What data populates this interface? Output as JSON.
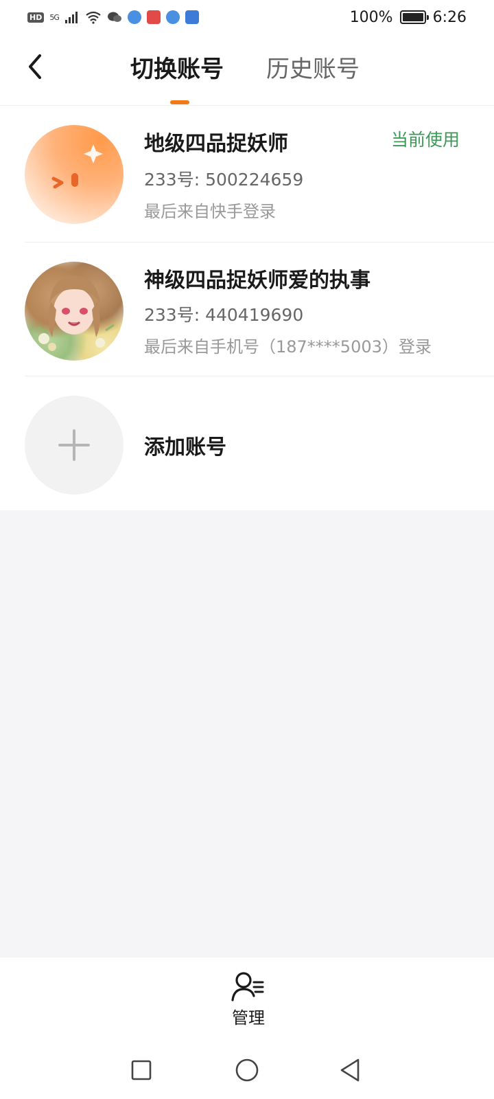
{
  "status_bar": {
    "battery_percent": "100%",
    "time": "6:26",
    "network": "5G",
    "hd": "HD"
  },
  "header": {
    "tabs": [
      {
        "label": "切换账号",
        "active": true
      },
      {
        "label": "历史账号",
        "active": false
      }
    ],
    "accent_color": "#f07a18"
  },
  "accounts": [
    {
      "name": "地级四品捉妖师",
      "id_line": "233号: 500224659",
      "source": "最后来自快手登录",
      "current_label": "当前使用"
    },
    {
      "name": "神级四品捉妖师爱的执事",
      "id_line": "233号: 440419690",
      "source": "最后来自手机号（187****5003）登录"
    }
  ],
  "add_account": {
    "label": "添加账号"
  },
  "manage": {
    "label": "管理"
  },
  "colors": {
    "current_label": "#3d9a55",
    "background": "#f5f5f7"
  }
}
